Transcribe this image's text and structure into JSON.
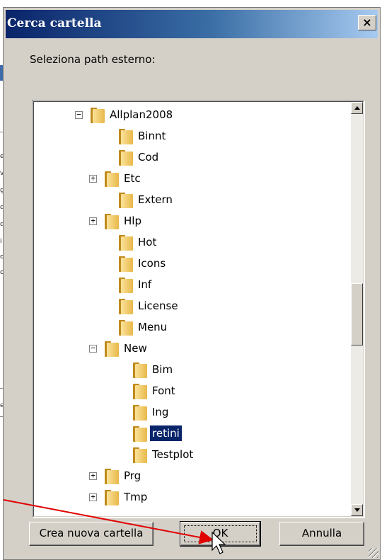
{
  "background_app": {
    "fragments": [
      "e",
      "v",
      "g",
      "d",
      "d",
      "i",
      "ol",
      "ol",
      "e"
    ]
  },
  "dialog": {
    "title": "Cerca cartella",
    "close_label": "×",
    "prompt": "Seleziona path esterno:",
    "tree": {
      "nodes": [
        {
          "label": "Allplan2008",
          "expander": "−",
          "selected": false
        },
        {
          "label": "Binnt",
          "expander": "",
          "selected": false
        },
        {
          "label": "Cod",
          "expander": "",
          "selected": false
        },
        {
          "label": "Etc",
          "expander": "+",
          "selected": false
        },
        {
          "label": "Extern",
          "expander": "",
          "selected": false
        },
        {
          "label": "Hlp",
          "expander": "+",
          "selected": false
        },
        {
          "label": "Hot",
          "expander": "",
          "selected": false
        },
        {
          "label": "Icons",
          "expander": "",
          "selected": false
        },
        {
          "label": "Inf",
          "expander": "",
          "selected": false
        },
        {
          "label": "License",
          "expander": "",
          "selected": false
        },
        {
          "label": "Menu",
          "expander": "",
          "selected": false
        },
        {
          "label": "New",
          "expander": "−",
          "selected": false
        },
        {
          "label": "Bim",
          "expander": "",
          "selected": false
        },
        {
          "label": "Font",
          "expander": "",
          "selected": false
        },
        {
          "label": "Ing",
          "expander": "",
          "selected": false
        },
        {
          "label": "retini",
          "expander": "",
          "selected": true
        },
        {
          "label": "Testplot",
          "expander": "",
          "selected": false
        },
        {
          "label": "Prg",
          "expander": "+",
          "selected": false
        },
        {
          "label": "Tmp",
          "expander": "+",
          "selected": false
        }
      ]
    },
    "buttons": {
      "new_folder": "Crea nuova cartella",
      "ok": "OK",
      "cancel": "Annulla"
    }
  },
  "colors": {
    "title_bar_start": "#0a246a",
    "selection": "#0a246a",
    "annotation_arrow": "#e00000"
  }
}
